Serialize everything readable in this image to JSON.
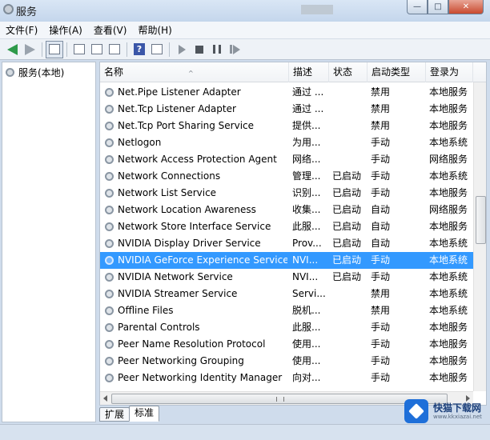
{
  "window": {
    "title": "服务",
    "buttons": {
      "minimize": "—",
      "maximize": "□",
      "close": "✕"
    }
  },
  "menu": [
    "文件(F)",
    "操作(A)",
    "查看(V)",
    "帮助(H)"
  ],
  "toolbar": {
    "icons": [
      "back-arrow-icon",
      "forward-arrow-icon",
      "console-tree-icon",
      "properties-icon",
      "refresh-icon",
      "export-list-icon",
      "help-icon",
      "show-action-pane-icon",
      "start-service-icon",
      "stop-service-icon",
      "pause-service-icon",
      "restart-service-icon"
    ],
    "help_glyph": "?"
  },
  "tree": {
    "root_label": "服务(本地)"
  },
  "columns": {
    "name": "名称",
    "desc": "描述",
    "status": "状态",
    "startup": "启动类型",
    "logon": "登录为",
    "sort_caret": "^"
  },
  "services": [
    {
      "name": "Net.Pipe Listener Adapter",
      "desc": "通过 ...",
      "status": "",
      "startup": "禁用",
      "logon": "本地服务"
    },
    {
      "name": "Net.Tcp Listener Adapter",
      "desc": "通过 ...",
      "status": "",
      "startup": "禁用",
      "logon": "本地服务"
    },
    {
      "name": "Net.Tcp Port Sharing Service",
      "desc": "提供...",
      "status": "",
      "startup": "禁用",
      "logon": "本地服务"
    },
    {
      "name": "Netlogon",
      "desc": "为用...",
      "status": "",
      "startup": "手动",
      "logon": "本地系统"
    },
    {
      "name": "Network Access Protection Agent",
      "desc": "网络...",
      "status": "",
      "startup": "手动",
      "logon": "网络服务"
    },
    {
      "name": "Network Connections",
      "desc": "管理...",
      "status": "已启动",
      "startup": "手动",
      "logon": "本地系统"
    },
    {
      "name": "Network List Service",
      "desc": "识别...",
      "status": "已启动",
      "startup": "手动",
      "logon": "本地服务"
    },
    {
      "name": "Network Location Awareness",
      "desc": "收集...",
      "status": "已启动",
      "startup": "自动",
      "logon": "网络服务"
    },
    {
      "name": "Network Store Interface Service",
      "desc": "此服...",
      "status": "已启动",
      "startup": "自动",
      "logon": "本地服务"
    },
    {
      "name": "NVIDIA Display Driver Service",
      "desc": "Prov...",
      "status": "已启动",
      "startup": "自动",
      "logon": "本地系统"
    },
    {
      "name": "NVIDIA GeForce Experience Service",
      "desc": "NVI...",
      "status": "已启动",
      "startup": "手动",
      "logon": "本地系统",
      "selected": true
    },
    {
      "name": "NVIDIA Network Service",
      "desc": "NVI...",
      "status": "已启动",
      "startup": "手动",
      "logon": "本地系统"
    },
    {
      "name": "NVIDIA Streamer Service",
      "desc": "Servi...",
      "status": "",
      "startup": "禁用",
      "logon": "本地系统"
    },
    {
      "name": "Offline Files",
      "desc": "脱机...",
      "status": "",
      "startup": "禁用",
      "logon": "本地系统"
    },
    {
      "name": "Parental Controls",
      "desc": "此服...",
      "status": "",
      "startup": "手动",
      "logon": "本地服务"
    },
    {
      "name": "Peer Name Resolution Protocol",
      "desc": "使用...",
      "status": "",
      "startup": "手动",
      "logon": "本地服务"
    },
    {
      "name": "Peer Networking Grouping",
      "desc": "使用...",
      "status": "",
      "startup": "手动",
      "logon": "本地服务"
    },
    {
      "name": "Peer Networking Identity Manager",
      "desc": "向对...",
      "status": "",
      "startup": "手动",
      "logon": "本地服务"
    }
  ],
  "scroll": {
    "h_grip": "|||"
  },
  "tabs": [
    "扩展",
    "标准"
  ],
  "watermark": {
    "main": "快猫下载网",
    "sub": "www.kkxiazai.net"
  },
  "colors": {
    "selection": "#3399ff",
    "title_gradient_top": "#d9e6f5",
    "close_button": "#c9492e"
  }
}
